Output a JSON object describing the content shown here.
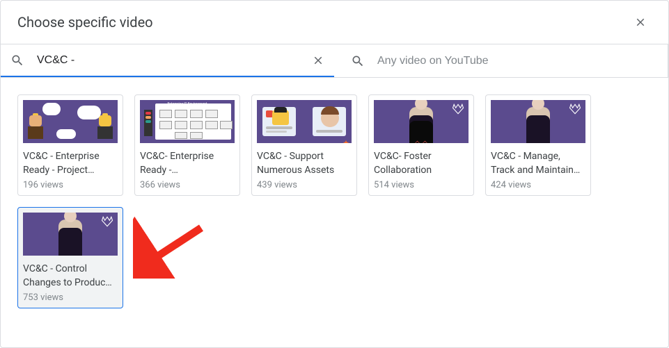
{
  "dialog": {
    "title": "Choose specific video"
  },
  "search": {
    "query": "VC&C - ",
    "placeholder_secondary": "Any video on YouTube"
  },
  "results": [
    {
      "title": "VC&C - Enterprise Ready - Project…",
      "views": "196 views",
      "thumb": "slide1",
      "selected": false
    },
    {
      "title": "VC&C- Enterprise Ready -…",
      "views": "366 views",
      "thumb": "slide2",
      "selected": false
    },
    {
      "title": "VC&C - Support Numerous Assets",
      "views": "439 views",
      "thumb": "slide3",
      "selected": false
    },
    {
      "title": "VC&C- Foster Collaboration",
      "views": "514 views",
      "thumb": "purple_black",
      "selected": false
    },
    {
      "title": "VC&C - Manage, Track and Maintain…",
      "views": "424 views",
      "thumb": "purple_purple",
      "selected": false
    },
    {
      "title": "VC&C - Control Changes to Produc…",
      "views": "753 views",
      "thumb": "purple_purple",
      "selected": true
    }
  ]
}
